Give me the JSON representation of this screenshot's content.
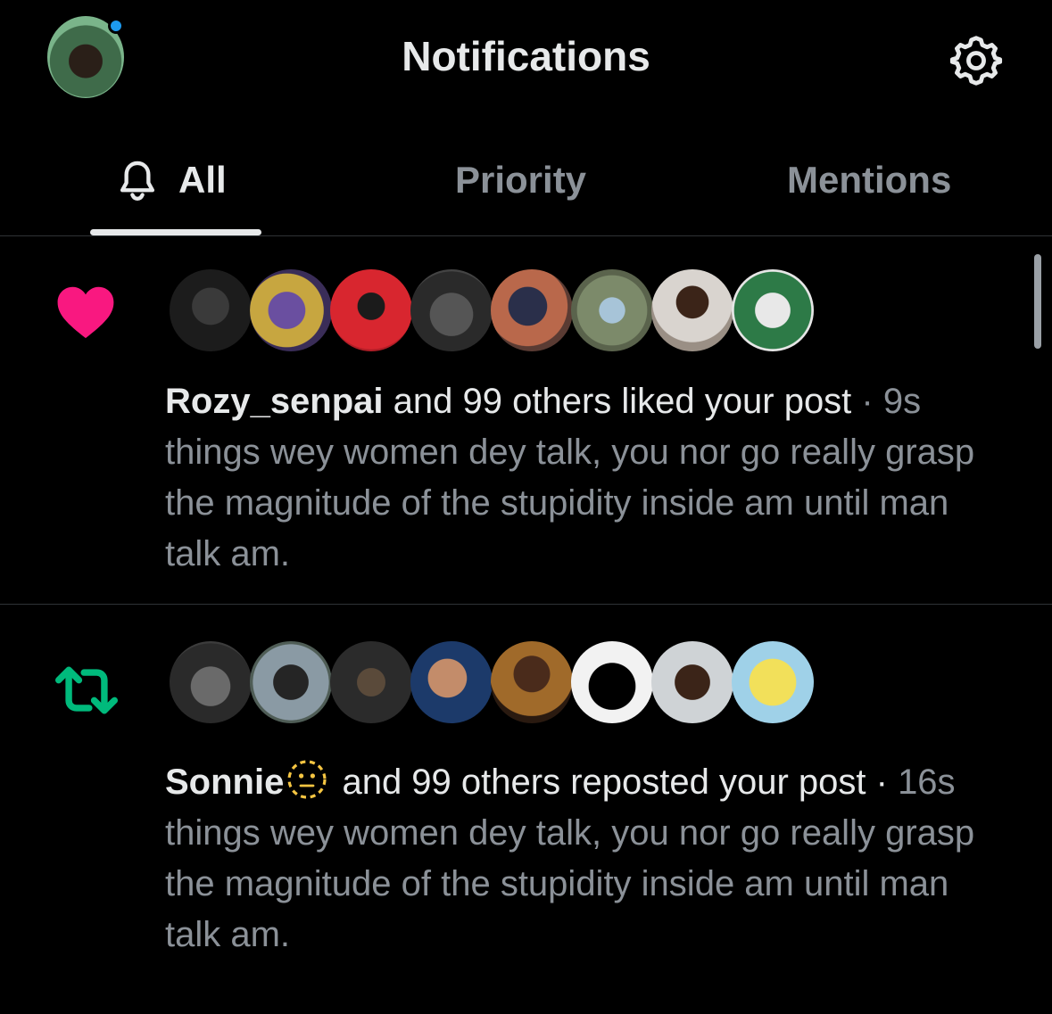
{
  "header": {
    "title": "Notifications",
    "profile_icon": "profile-avatar",
    "settings_icon": "gear-icon"
  },
  "tabs": [
    {
      "label": "All",
      "icon": "bell-icon",
      "active": true
    },
    {
      "label": "Priority",
      "active": false
    },
    {
      "label": "Mentions",
      "active": false
    }
  ],
  "notifications": [
    {
      "type": "like",
      "icon": "heart-icon",
      "icon_color": "#f91880",
      "actor": "Rozy_senpai",
      "action": " and 99 others liked your post",
      "time": " · 9s",
      "post": "things wey women dey talk, you nor go really grasp the magnitude of the stupidity inside am until man talk am.",
      "avatars": [
        "avatar-1",
        "avatar-2",
        "avatar-3",
        "avatar-4",
        "avatar-5",
        "avatar-6",
        "avatar-7",
        "avatar-8"
      ]
    },
    {
      "type": "repost",
      "icon": "repost-icon",
      "icon_color": "#00ba7c",
      "actor": "Sonnie",
      "actor_emoji": "dotted-line-face-emoji",
      "action": " and 99 others reposted your post · ",
      "time": "16s",
      "post": "things wey women dey talk, you nor go really grasp the magnitude of the stupidity inside am until man talk am.",
      "avatars": [
        "avatar-1",
        "avatar-2",
        "avatar-3",
        "avatar-4",
        "avatar-5",
        "avatar-6",
        "avatar-7",
        "avatar-8"
      ]
    }
  ],
  "colors": {
    "background": "#000000",
    "text_primary": "#e7e9ea",
    "text_secondary": "#8b9198",
    "divider": "#2f3336",
    "unread_dot": "#1d9bf0"
  }
}
